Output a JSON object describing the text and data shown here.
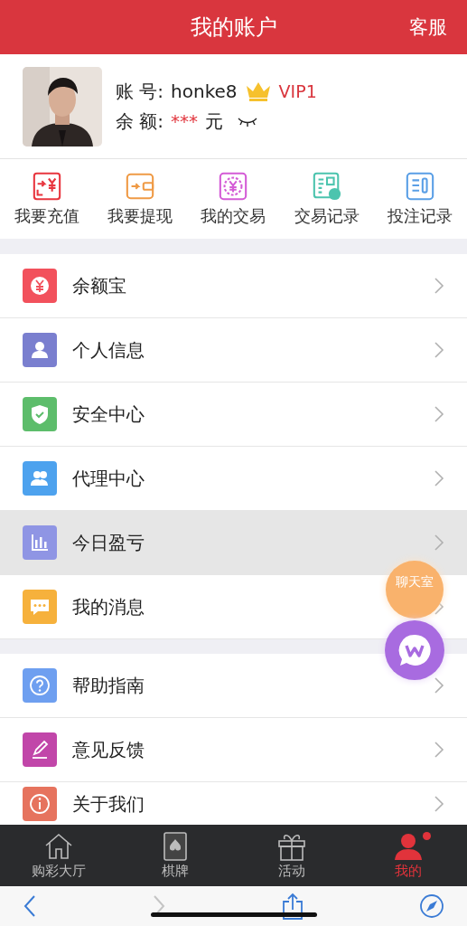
{
  "header": {
    "title": "我的账户",
    "action": "客服"
  },
  "profile": {
    "account_label": "账 号:",
    "account": "honke8",
    "vip": "VIP1",
    "balance_label": "余 额:",
    "balance": "***",
    "currency": "元"
  },
  "quick_actions": [
    {
      "label": "我要充值",
      "color": "#e8363f"
    },
    {
      "label": "我要提现",
      "color": "#ef9a45"
    },
    {
      "label": "我的交易",
      "color": "#d45cd6"
    },
    {
      "label": "交易记录",
      "color": "#4cc4ae"
    },
    {
      "label": "投注记录",
      "color": "#5a9fe6"
    }
  ],
  "menu_sections": [
    {
      "items": [
        {
          "label": "余额宝",
          "color": "#f2515c",
          "selected": false
        },
        {
          "label": "个人信息",
          "color": "#7a7fcf",
          "selected": false
        },
        {
          "label": "安全中心",
          "color": "#5dbd6b",
          "selected": false
        },
        {
          "label": "代理中心",
          "color": "#4da2ee",
          "selected": false
        },
        {
          "label": "今日盈亏",
          "color": "#8f95e4",
          "selected": true
        },
        {
          "label": "我的消息",
          "color": "#f6b13c",
          "selected": false
        }
      ]
    },
    {
      "items": [
        {
          "label": "帮助指南",
          "color": "#6e9ff0",
          "selected": false
        },
        {
          "label": "意见反馈",
          "color": "#c146a9",
          "selected": false
        },
        {
          "label": "关于我们",
          "color": "#e6735e",
          "selected": false
        }
      ]
    }
  ],
  "chat_bubble": {
    "label": "聊天室"
  },
  "tab_bar": [
    {
      "label": "购彩大厅",
      "selected": false,
      "dot": false
    },
    {
      "label": "棋牌",
      "selected": false,
      "dot": false
    },
    {
      "label": "活动",
      "selected": false,
      "dot": false
    },
    {
      "label": "我的",
      "selected": true,
      "dot": true
    }
  ]
}
